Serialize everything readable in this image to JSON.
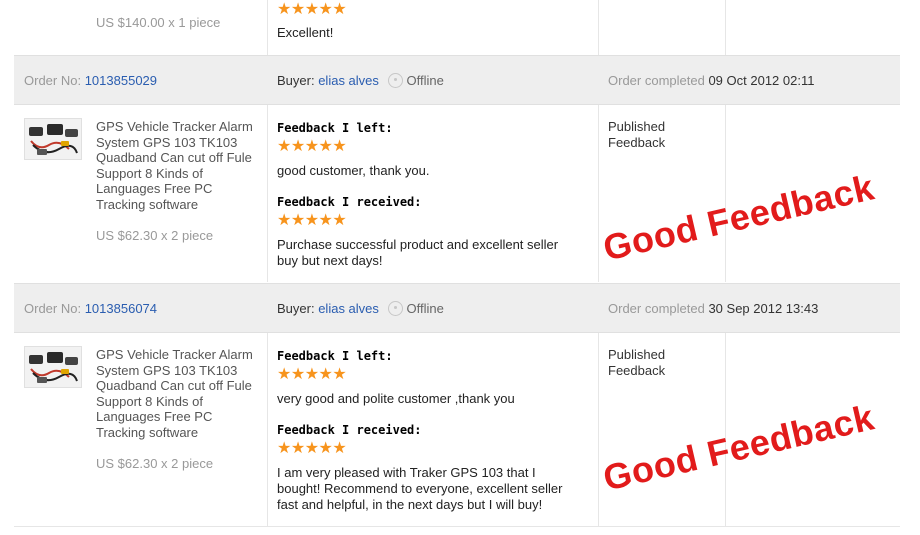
{
  "top_row": {
    "price": "US $140.00 x 1 piece",
    "stars": "★★★★★",
    "feedback": "Excellent!"
  },
  "orders": [
    {
      "order_label": "Order No:",
      "order_no": "1013855029",
      "buyer_label": "Buyer:",
      "buyer_name": "elias alves",
      "online_status": "Offline",
      "completed_label": "Order completed",
      "completed_date": "09 Oct 2012 02:11",
      "product_title": "GPS Vehicle Tracker Alarm System GPS 103 TK103 Quadband Can cut off Fule Support 8 Kinds of Languages Free PC Tracking software",
      "price": "US $62.30 x 2 piece",
      "feedback_left_heading": "Feedback I left:",
      "feedback_left_stars": "★★★★★",
      "feedback_left_text": "good customer, thank you.",
      "feedback_received_heading": "Feedback I received:",
      "feedback_received_stars": "★★★★★",
      "feedback_received_text": "Purchase successful product and excellent seller buy but next days!",
      "status_line1": "Published",
      "status_line2": "Feedback",
      "overlay": "Good Feedback"
    },
    {
      "order_label": "Order No:",
      "order_no": "1013856074",
      "buyer_label": "Buyer:",
      "buyer_name": "elias alves",
      "online_status": "Offline",
      "completed_label": "Order completed",
      "completed_date": "30 Sep 2012 13:43",
      "product_title": "GPS Vehicle Tracker Alarm System GPS 103 TK103 Quadband Can cut off Fule Support 8 Kinds of Languages Free PC Tracking software",
      "price": "US $62.30 x 2 piece",
      "feedback_left_heading": "Feedback I left:",
      "feedback_left_stars": "★★★★★",
      "feedback_left_text": "very good and polite customer ,thank you",
      "feedback_received_heading": "Feedback I received:",
      "feedback_received_stars": "★★★★★",
      "feedback_received_text": "I am very pleased with Traker GPS 103 that I bought! Recommend to everyone, excellent seller fast and helpful, in the next days but I will buy!",
      "status_line1": "Published",
      "status_line2": "Feedback",
      "overlay": "Good Feedback"
    }
  ],
  "colors": {
    "link": "#2a5db0",
    "stars": "#f7941d",
    "overlay": "#e21b1b",
    "header_bg": "#eeeeee"
  },
  "icons": [
    "offline-status-icon",
    "product-thumbnail"
  ]
}
